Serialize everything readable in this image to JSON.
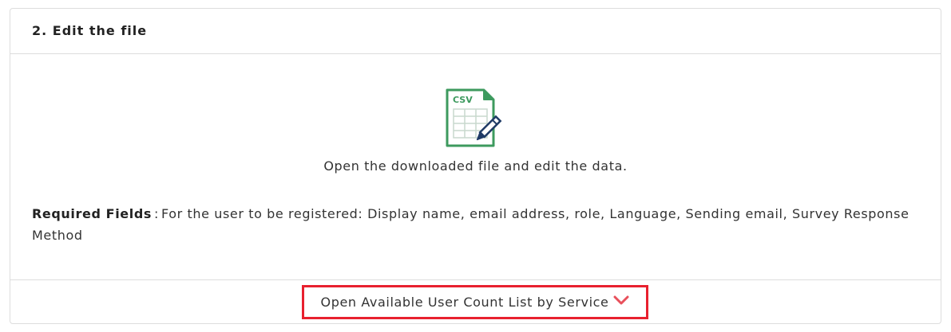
{
  "section": {
    "title": "2. Edit the file"
  },
  "icon": {
    "name": "csv-edit-icon",
    "text": "CSV",
    "color": "#3d9a5e",
    "pencil_color": "#1f3b66"
  },
  "description": "Open the downloaded file and edit the data.",
  "required": {
    "label": "Required Fields",
    "separator": ":",
    "text": "For the user to be registered: Display name, email address, role, Language, Sending email, Survey Response Method"
  },
  "footer": {
    "toggle_label": "Open Available User Count List by Service",
    "chevron_icon": "chevron-down-icon",
    "chevron_color": "#e8505b",
    "highlight_color": "#e8202e"
  }
}
